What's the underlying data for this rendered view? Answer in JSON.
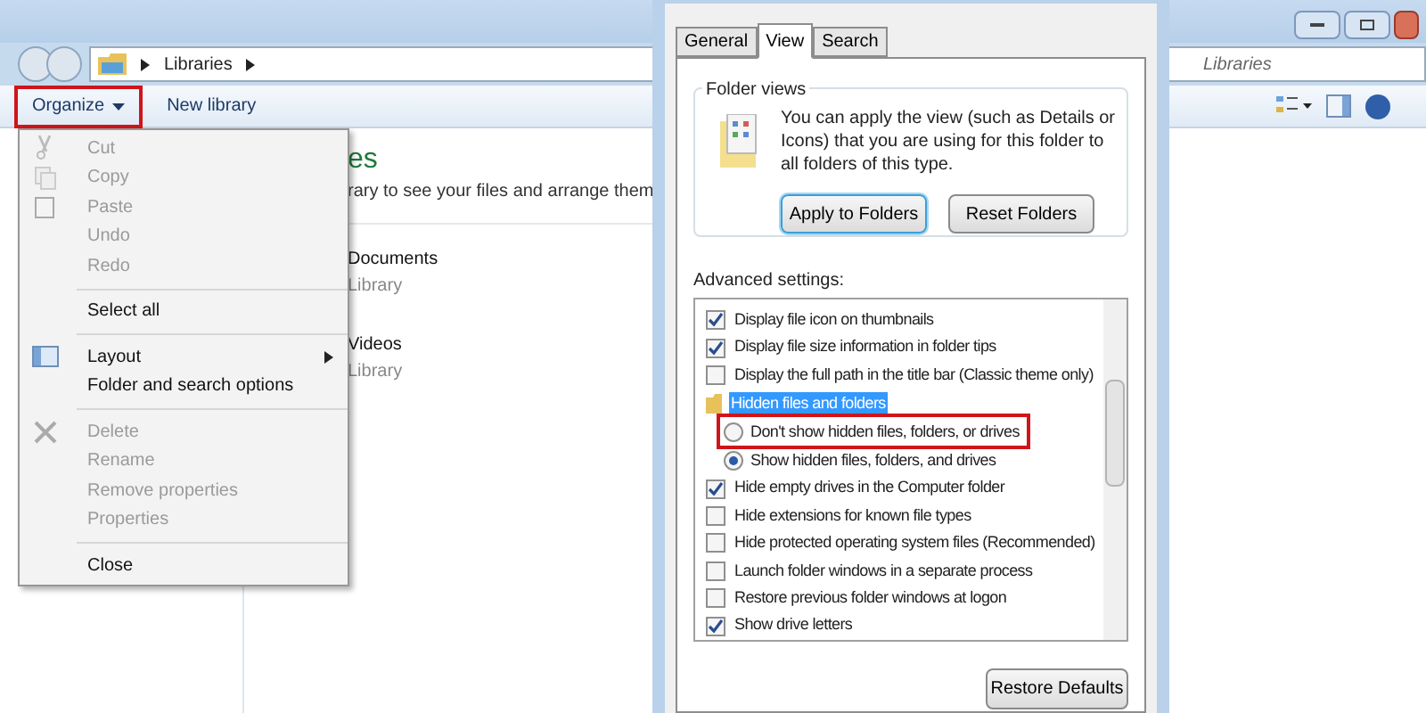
{
  "explorer": {
    "address": [
      "Libraries"
    ],
    "search_placeholder": "Libraries",
    "toolbar": [
      {
        "label": "Organize",
        "dropdown": true,
        "highlighted": true
      },
      {
        "label": "New library",
        "dropdown": false,
        "highlighted": false
      }
    ],
    "content": {
      "heading": "es",
      "subtitle": "rary to see your files and arrange them",
      "libraries": [
        {
          "name": "Documents",
          "type": "Library"
        },
        {
          "name": "Videos",
          "type": "Library"
        }
      ]
    }
  },
  "organize_menu": [
    {
      "kind": "item",
      "label": "Cut",
      "disabled": true,
      "submenu": false
    },
    {
      "kind": "item",
      "label": "Copy",
      "disabled": true,
      "submenu": false
    },
    {
      "kind": "item",
      "label": "Paste",
      "disabled": true,
      "submenu": false
    },
    {
      "kind": "item",
      "label": "Undo",
      "disabled": true,
      "submenu": false
    },
    {
      "kind": "item",
      "label": "Redo",
      "disabled": true,
      "submenu": false
    },
    {
      "kind": "separator"
    },
    {
      "kind": "item",
      "label": "Select all",
      "disabled": false,
      "submenu": false
    },
    {
      "kind": "separator"
    },
    {
      "kind": "item",
      "label": "Layout",
      "disabled": false,
      "submenu": true
    },
    {
      "kind": "item",
      "label": "Folder and search options",
      "disabled": false,
      "submenu": false
    },
    {
      "kind": "separator"
    },
    {
      "kind": "item",
      "label": "Delete",
      "disabled": true,
      "submenu": false
    },
    {
      "kind": "item",
      "label": "Rename",
      "disabled": true,
      "submenu": false
    },
    {
      "kind": "item",
      "label": "Remove properties",
      "disabled": true,
      "submenu": false
    },
    {
      "kind": "item",
      "label": "Properties",
      "disabled": true,
      "submenu": false
    },
    {
      "kind": "separator"
    },
    {
      "kind": "item",
      "label": "Close",
      "disabled": false,
      "submenu": false
    }
  ],
  "folder_options": {
    "tabs": [
      {
        "label": "General",
        "selected": false
      },
      {
        "label": "View",
        "selected": true
      },
      {
        "label": "Search",
        "selected": false
      }
    ],
    "folder_views": {
      "title": "Folder views",
      "text": "You can apply the view (such as Details or Icons) that you are using for this folder to all folders of this type.",
      "buttons": [
        {
          "label": "Apply to Folders",
          "focused": true
        },
        {
          "label": "Reset Folders",
          "focused": false
        }
      ]
    },
    "advanced_label": "Advanced settings:",
    "advanced": [
      {
        "kind": "checkbox",
        "label": "Display file icon on thumbnails",
        "checked": true,
        "selected": false
      },
      {
        "kind": "checkbox",
        "label": "Display file size information in folder tips",
        "checked": true,
        "selected": false
      },
      {
        "kind": "checkbox",
        "label": "Display the full path in the title bar (Classic theme only)",
        "checked": false,
        "selected": false
      },
      {
        "kind": "folder",
        "label": "Hidden files and folders",
        "selected": true,
        "children": [
          {
            "label": "Don't show hidden files, folders, or drives",
            "checked": false,
            "highlighted": true
          },
          {
            "label": "Show hidden files, folders, and drives",
            "checked": true,
            "highlighted": false
          }
        ]
      },
      {
        "kind": "checkbox",
        "label": "Hide empty drives in the Computer folder",
        "checked": true,
        "selected": false
      },
      {
        "kind": "checkbox",
        "label": "Hide extensions for known file types",
        "checked": false,
        "selected": false
      },
      {
        "kind": "checkbox",
        "label": "Hide protected operating system files (Recommended)",
        "checked": false,
        "selected": false
      },
      {
        "kind": "checkbox",
        "label": "Launch folder windows in a separate process",
        "checked": false,
        "selected": false
      },
      {
        "kind": "checkbox",
        "label": "Restore previous folder windows at logon",
        "checked": false,
        "selected": false
      },
      {
        "kind": "checkbox",
        "label": "Show drive letters",
        "checked": true,
        "selected": false
      }
    ],
    "restore_button": "Restore Defaults"
  }
}
